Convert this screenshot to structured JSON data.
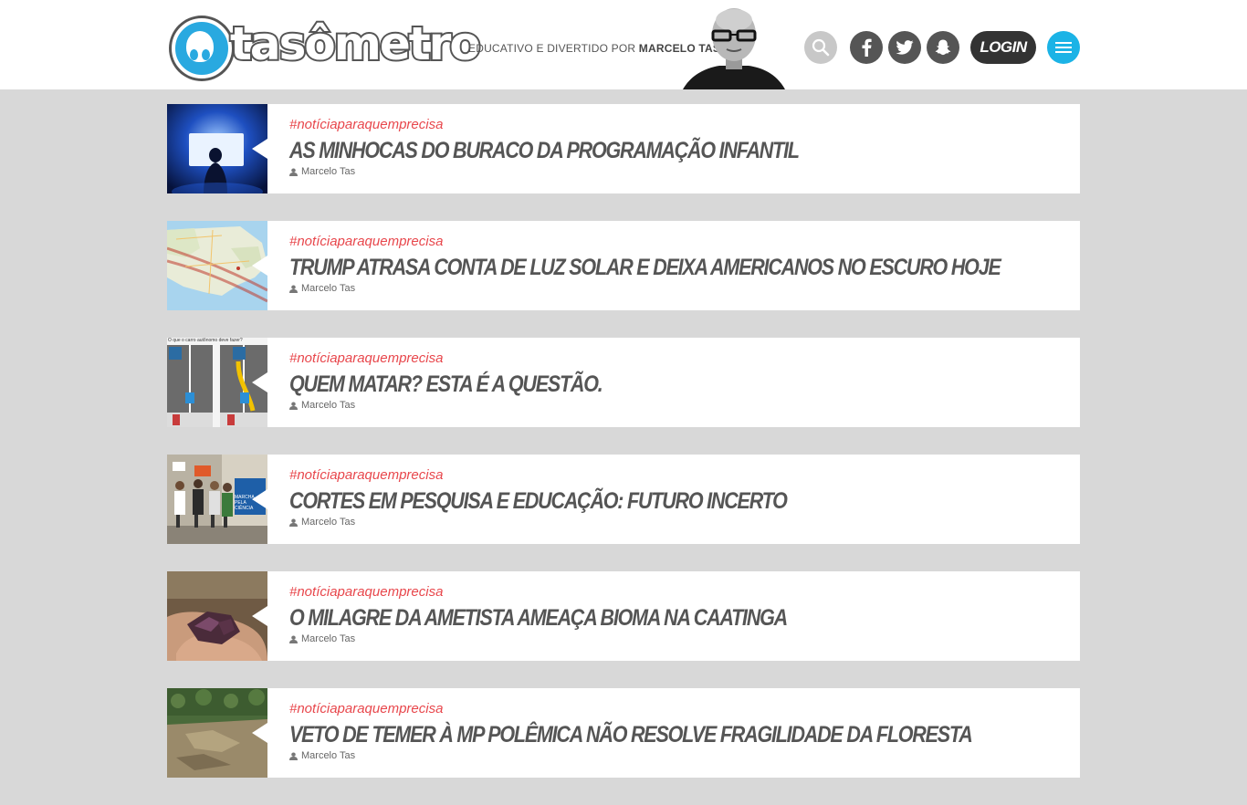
{
  "header": {
    "logo_text": "tasômetro",
    "tagline_prefix": "EDUCATIVO E DIVERTIDO POR",
    "tagline_author": "MARCELO TAS",
    "login_label": "LOGIN",
    "icons": {
      "search": "search-icon",
      "facebook": "facebook-icon",
      "twitter": "twitter-icon",
      "snapchat": "snapchat-icon",
      "menu": "hamburger-menu-icon"
    }
  },
  "colors": {
    "accent_red": "#e8474c",
    "menu_blue": "#1bb3e6",
    "title_gray": "#555555",
    "background": "#d8d8d8"
  },
  "articles": [
    {
      "hashtag": "#notíciaparaquemprecisa",
      "title": "AS MINHOCAS DO BURACO DA PROGRAMAÇÃO INFANTIL",
      "author": "Marcelo Tas"
    },
    {
      "hashtag": "#notíciaparaquemprecisa",
      "title": "TRUMP ATRASA CONTA DE LUZ SOLAR E DEIXA AMERICANOS NO ESCURO HOJE",
      "author": "Marcelo Tas"
    },
    {
      "hashtag": "#notíciaparaquemprecisa",
      "title": "QUEM MATAR? ESTA É A QUESTÃO.",
      "author": "Marcelo Tas",
      "thumb_caption": "O que o carro autônomo deve fazer?"
    },
    {
      "hashtag": "#notíciaparaquemprecisa",
      "title": "CORTES EM PESQUISA E EDUCAÇÃO: FUTURO INCERTO",
      "author": "Marcelo Tas",
      "thumb_caption": "MARCHA PELA CIÊNCIA"
    },
    {
      "hashtag": "#notíciaparaquemprecisa",
      "title": "O MILAGRE DA AMETISTA AMEAÇA BIOMA NA CAATINGA",
      "author": "Marcelo Tas"
    },
    {
      "hashtag": "#notíciaparaquemprecisa",
      "title": "VETO DE TEMER À MP POLÊMICA NÃO RESOLVE FRAGILIDADE DA FLORESTA",
      "author": "Marcelo Tas"
    }
  ]
}
